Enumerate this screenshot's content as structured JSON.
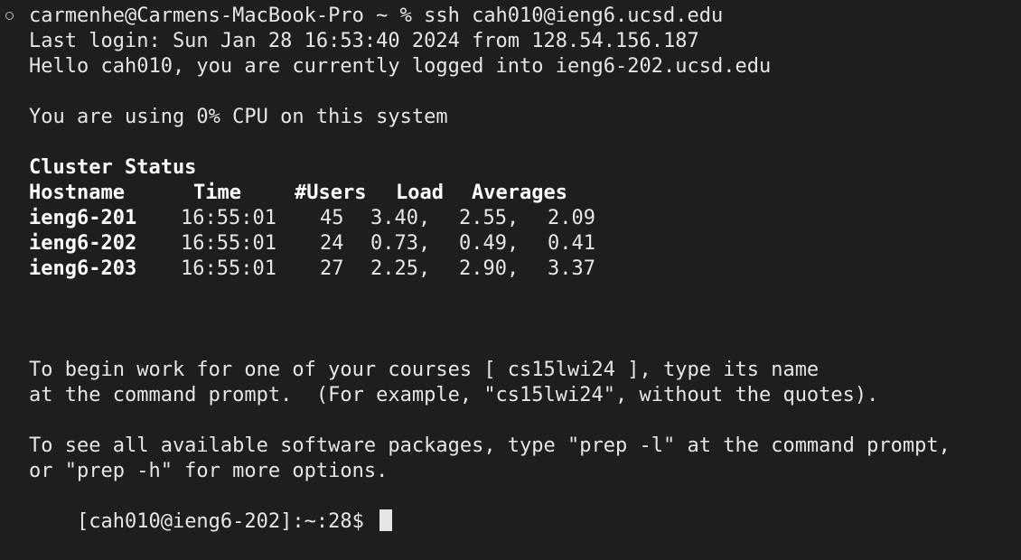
{
  "terminal": {
    "command_line": "carmenhe@Carmens-MacBook-Pro ~ % ssh cah010@ieng6.ucsd.edu",
    "last_login": "Last login: Sun Jan 28 16:53:40 2024 from 128.54.156.187",
    "hello": "Hello cah010, you are currently logged into ieng6-202.ucsd.edu",
    "cpu_usage": "You are using 0% CPU on this system",
    "cluster_status_title": "Cluster Status",
    "cluster_headers": {
      "hostname": "Hostname",
      "time": "Time",
      "users": "#Users",
      "load": "Load",
      "averages": "Averages"
    },
    "cluster_rows": [
      {
        "hostname": "ieng6-201",
        "time": "16:55:01",
        "users": "45",
        "load1": "3.40,",
        "load2": "2.55,",
        "load3": "2.09"
      },
      {
        "hostname": "ieng6-202",
        "time": "16:55:01",
        "users": "24",
        "load1": "0.73,",
        "load2": "0.49,",
        "load3": "0.41"
      },
      {
        "hostname": "ieng6-203",
        "time": "16:55:01",
        "users": "27",
        "load1": "2.25,",
        "load2": "2.90,",
        "load3": "3.37"
      }
    ],
    "courses_line1": "To begin work for one of your courses [ cs15lwi24 ], type its name",
    "courses_line2": "at the command prompt.  (For example, \"cs15lwi24\", without the quotes).",
    "packages_line1": "To see all available software packages, type \"prep -l\" at the command prompt,",
    "packages_line2": "or \"prep -h\" for more options.",
    "prompt": "[cah010@ieng6-202]:~:28$ "
  },
  "colors": {
    "background": "#1e1e1e",
    "text": "#e6e6e6",
    "bold_text": "#ffffff"
  }
}
